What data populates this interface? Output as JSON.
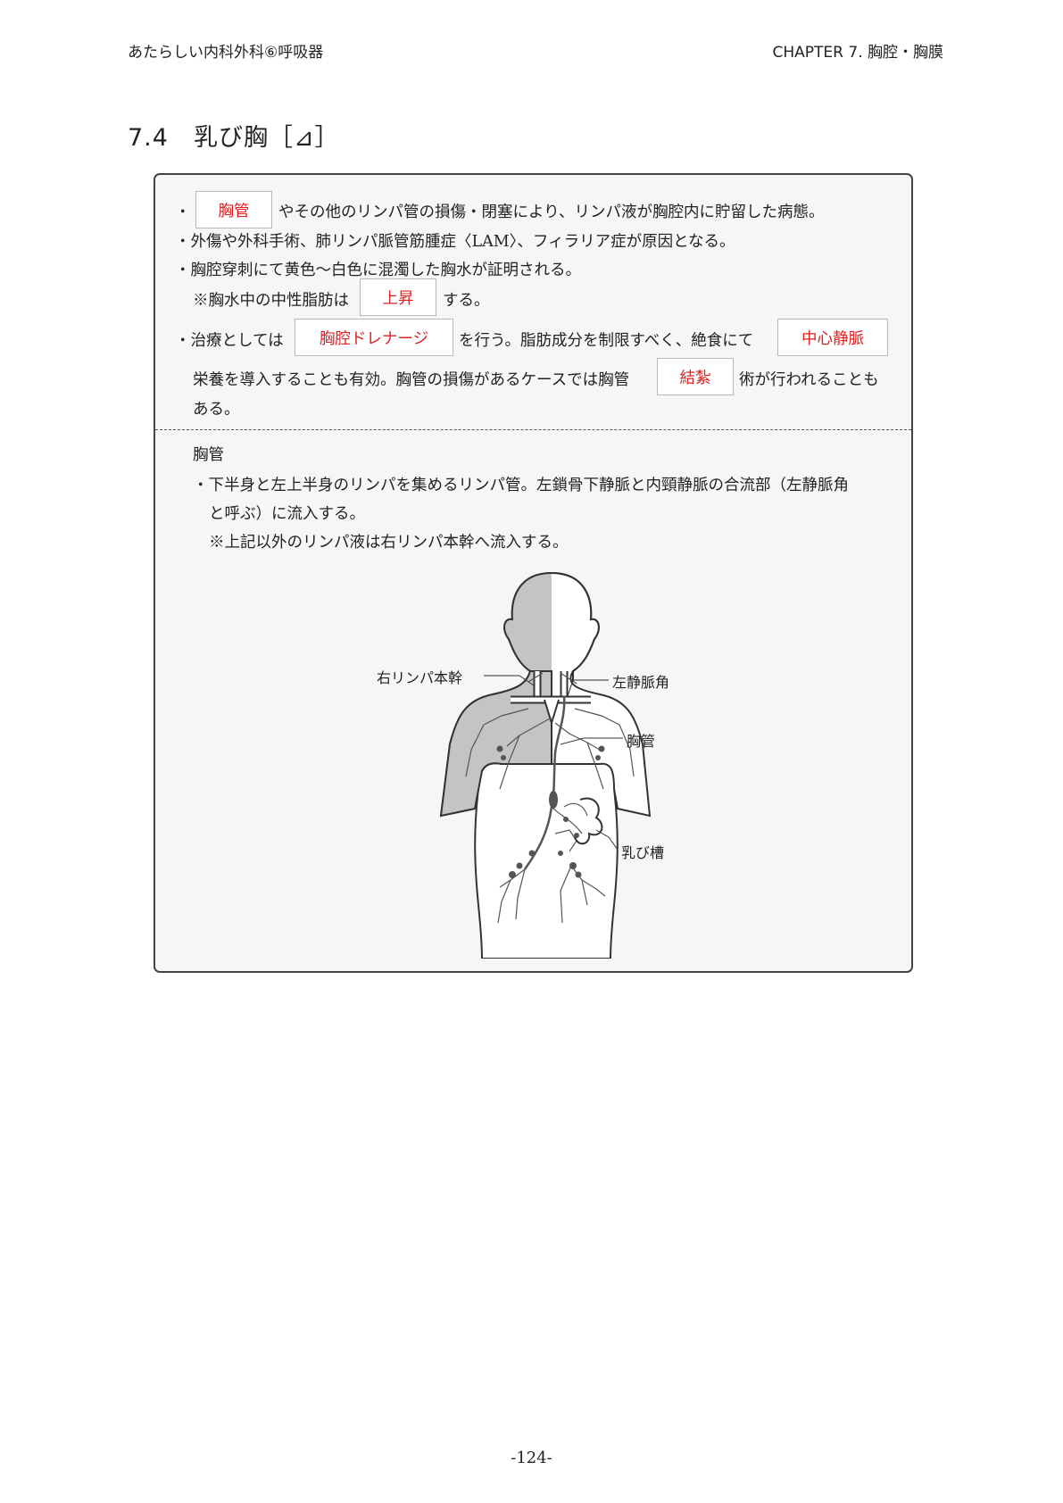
{
  "header": {
    "left": "あたらしい内科外科⑥呼吸器",
    "right": "CHAPTER 7. 胸腔・胸膜"
  },
  "section_title": "7.4　乳び胸［⊿］",
  "box": {
    "l1": {
      "bullet": "・",
      "blank": "胸管",
      "rest": "やその他のリンパ管の損傷・閉塞により、リンパ液が胸腔内に貯留した病態。"
    },
    "l2": "・外傷や外科手術、肺リンパ脈管筋腫症〈LAM〉、フィラリア症が原因となる。",
    "l3": "・胸腔穿刺にて黄色〜白色に混濁した胸水が証明される。",
    "l4": {
      "pre": "※胸水中の中性脂肪は",
      "blank": "上昇",
      "post": "する。"
    },
    "l5": {
      "pre": "・治療としては",
      "blank1": "胸腔ドレナージ",
      "mid": "を行う。脂肪成分を制限すべく、絶食にて",
      "blank2": "中心静脈"
    },
    "l6": {
      "pre": "栄養を導入することも有効。胸管の損傷があるケースでは胸管",
      "blank": "結紮",
      "post": "術が行われることも"
    },
    "l7": "ある。",
    "sub_title": "胸管",
    "s1": "・下半身と左上半身のリンパを集めるリンパ管。左鎖骨下静脈と内頸静脈の合流部（左静脈角",
    "s2": "と呼ぶ）に流入する。",
    "s3": "※上記以外のリンパ液は右リンパ本幹へ流入する。"
  },
  "figure": {
    "labels": {
      "right_lymph_trunk": "右リンパ本幹",
      "left_venous_angle": "左静脈角",
      "thoracic_duct": "胸管",
      "cisterna_chyli": "乳び槽"
    }
  },
  "page_number": "-124-",
  "colors": {
    "answer_red": "#e02020",
    "box_bg": "#f6f6f6",
    "shade": "#c4c4c4"
  }
}
